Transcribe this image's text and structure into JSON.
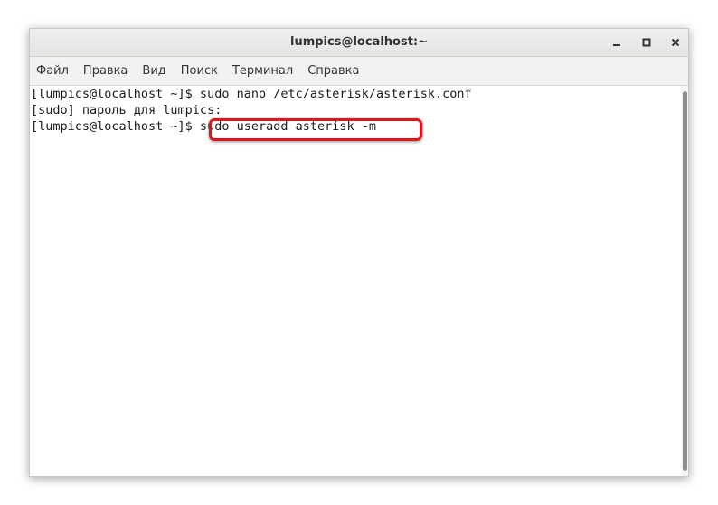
{
  "window": {
    "title": "lumpics@localhost:~",
    "controls": {
      "minimize": "~",
      "maximize": "□",
      "close": "×"
    }
  },
  "menu": {
    "items": [
      "Файл",
      "Правка",
      "Вид",
      "Поиск",
      "Терминал",
      "Справка"
    ]
  },
  "terminal": {
    "lines": [
      "[lumpics@localhost ~]$ sudo nano /etc/asterisk/asterisk.conf",
      "[sudo] пароль для lumpics:",
      "[lumpics@localhost ~]$ sudo useradd asterisk -m"
    ],
    "highlight_color": "#e0141a"
  }
}
